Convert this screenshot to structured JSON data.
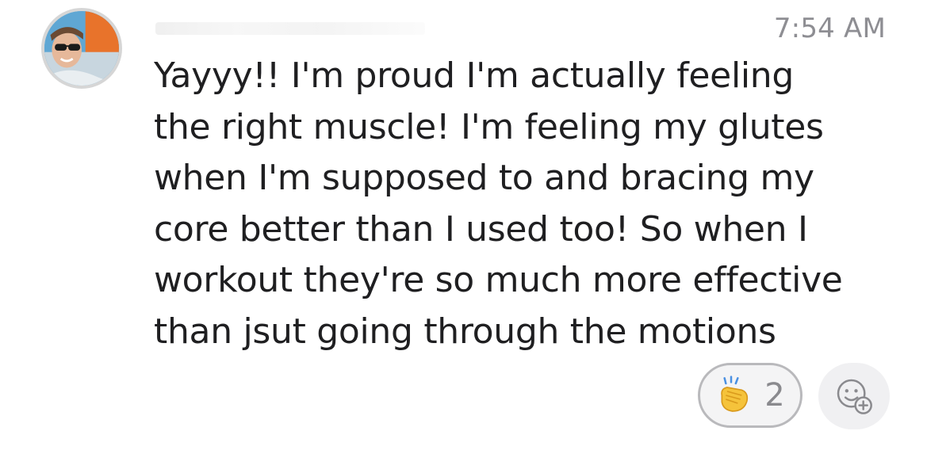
{
  "message": {
    "timestamp": "7:54 AM",
    "lines": [
      "Yayyy!! I'm proud I'm actually feeling",
      "the right muscle! I'm feeling my glutes",
      "when I'm supposed to and bracing my",
      "core better than I used too! So when I",
      "workout they're so much more effective",
      "than jsut going through the motions"
    ]
  },
  "reactions": [
    {
      "icon": "clapping-hands-icon",
      "count": "2"
    }
  ],
  "colors": {
    "timestamp": "#8e8e93",
    "pill_border": "#b9b9bc",
    "pill_bg": "#f4f4f5"
  }
}
